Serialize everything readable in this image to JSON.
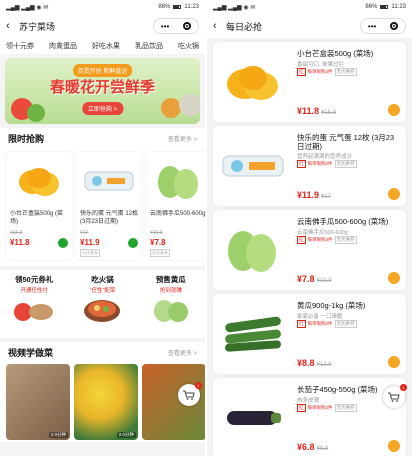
{
  "left": {
    "status": {
      "signal": "▂▄▆ ▂▄▆ ◉ ✉",
      "battery": "86%",
      "time": "11:23"
    },
    "title": "苏宁菜场",
    "capsule_dots": "•••",
    "categories": [
      "领十元券",
      "肉禽蛋品",
      "好吃水果",
      "乳品饮品",
      "吃火锅"
    ],
    "banner": {
      "tag": "百货开抢 新鲜直达",
      "title": "春暖花开尝鲜季",
      "button": "立即抢购 >"
    },
    "flash": {
      "heading": "限时抢购",
      "more": "查看更多 >",
      "items": [
        {
          "name": "小台芒盒装500g (菜场)",
          "old": "¥15.8",
          "price": "¥11.8",
          "tag": ""
        },
        {
          "name": "快乐的蛋 元气蛋 12枚 (3月23日过期)",
          "old": "¥17",
          "price": "¥11.9",
          "tag": "无优惠券"
        },
        {
          "name": "云南佛手瓜500-600g",
          "old": "¥10.9",
          "price": "¥7.8",
          "tag": "无优惠券"
        }
      ]
    },
    "promos": [
      {
        "title": "领50元券礼",
        "sub": "开通任性付"
      },
      {
        "title": "吃火锅",
        "sub": "“任性”配菜"
      },
      {
        "title": "预售黄瓜",
        "sub": "抢到就赚"
      }
    ],
    "video": {
      "heading": "视频学做菜",
      "more": "查看更多 >",
      "times": [
        "2.0分钟",
        "2.0分钟",
        ""
      ]
    },
    "cart_badge": "1"
  },
  "right": {
    "status": {
      "signal": "▂▄▆ ▂▄▆ ◉ ✉",
      "battery": "86%",
      "time": "11:23"
    },
    "title": "每日必抢",
    "capsule_dots": "•••",
    "items": [
      {
        "name": "小台芒盒装500g (菜场)",
        "desc": "香甜可口, 单果过巨",
        "tag1": "红",
        "tag2": "每单限购2件",
        "tag3": "无优惠券",
        "price": "¥11.8",
        "old": "¥15.8"
      },
      {
        "name": "快乐的蛋 元气蛋 12枚 (3月23日过期)",
        "desc": "营养起满满的营养成分",
        "tag1": "红",
        "tag2": "每单限购2件",
        "tag3": "无优惠券",
        "price": "¥11.9",
        "old": "¥17"
      },
      {
        "name": "云南佛手瓜500-600g (菜场)",
        "desc": "云南佛手瓜500-600g",
        "tag1": "红",
        "tag2": "每单限购2件",
        "tag3": "无优惠券",
        "price": "¥7.8",
        "old": "¥10.9"
      },
      {
        "name": "黄瓜900g-1kg (菜场)",
        "desc": "家家必备 一口清脆",
        "tag1": "红",
        "tag2": "每单限购2件",
        "tag3": "无优惠券",
        "price": "¥8.8",
        "old": "¥12.8"
      },
      {
        "name": "长茄子450g-550g (菜场)",
        "desc": "肉多皮薄",
        "tag1": "红",
        "tag2": "每单限购2件",
        "tag3": "无优惠券",
        "price": "¥6.8",
        "old": "¥9.8"
      }
    ],
    "cart_badge": "1"
  },
  "colors": {
    "price_red": "#e2231a",
    "flash_cart": "#22a52c",
    "list_cart": "#f5a623",
    "banner_button": "#e8453a"
  }
}
